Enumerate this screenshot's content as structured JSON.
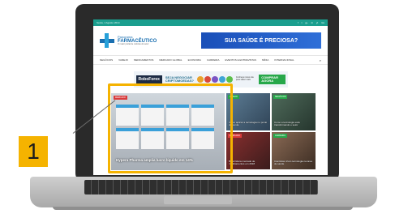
{
  "callout": {
    "number": "1"
  },
  "site": {
    "date": "Sexta, 1 Agosto 2014",
    "socials": [
      "f",
      "t",
      "g+",
      "in",
      "yt",
      "rss"
    ],
    "logo": {
      "line1": "Panorama",
      "line2": "FARMACÊUTICO",
      "tagline": "O maior portal de notícias do setor"
    },
    "top_banner": "SUA SAÚDE É PRECIOSA?",
    "nav": [
      "NEGÓCIOS",
      "VAREJO",
      "MEDICAMENTOS",
      "MERCADO GLOBAL",
      "ECONOMIA",
      "CARREIRA",
      "EVENTOS E ENTREVISTAS",
      "MÍDIA",
      "INTERNACIONAL"
    ],
    "ad": {
      "brand": "RoboForex",
      "text": "SEJA NEGOCIAR CRIPTOMOEDAS?",
      "note": "Conheça nosso site para saber mais",
      "cta": "COMPRAR AGORA"
    },
    "hero": {
      "tag": "MERCADO",
      "caption": "Hypera Pharma amplia lucro líquido em 14%"
    },
    "cards": [
      {
        "tag": "VAREJO",
        "title": "Como aplicar a tecnologia no ponto de venda"
      },
      {
        "tag": "NEGÓCIOS",
        "title": "Como a tecnologia está transformando o setor"
      },
      {
        "tag": "MERCADO",
        "title": "Brasil lidera mercado de medicamentos em 2018"
      },
      {
        "tag": "CARREIRA",
        "title": "Cientistas criam tecnologia na área de saúde"
      }
    ]
  }
}
